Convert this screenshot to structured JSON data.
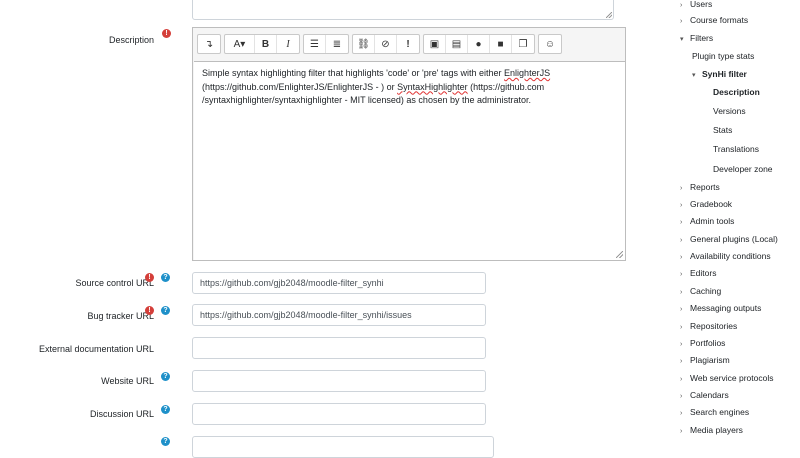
{
  "form": {
    "description": {
      "label": "Description",
      "content": {
        "part1": "Simple syntax highlighting filter that highlights 'code' or 'pre' tags with either ",
        "spell1": "EnlighterJS",
        "part2": " (https://github.com/EnlighterJS/EnlighterJS - ) or ",
        "spell2": "SyntaxHighlighter",
        "part3": " (https://github.com /syntaxhighlighter/syntaxhighlighter - MIT licensed) as chosen by the administrator."
      }
    },
    "source_control_url": {
      "label": "Source control URL",
      "value": "https://github.com/gjb2048/moodle-filter_synhi"
    },
    "bug_tracker_url": {
      "label": "Bug tracker URL",
      "value": "https://github.com/gjb2048/moodle-filter_synhi/issues"
    },
    "external_documentation_url": {
      "label": "External documentation URL",
      "value": ""
    },
    "website_url": {
      "label": "Website URL",
      "value": ""
    },
    "discussion_url": {
      "label": "Discussion URL",
      "value": ""
    }
  },
  "toolbar": {
    "icons": [
      "collapse-icon",
      "paragraph-style-icon",
      "bold-icon",
      "italic-icon",
      "unordered-list-icon",
      "ordered-list-icon",
      "link-icon",
      "unlink-icon",
      "emoji-picker-icon",
      "image-icon",
      "media-icon",
      "record-audio-icon",
      "record-video-icon",
      "manage-files-icon",
      "emoticon-icon"
    ]
  },
  "nav": {
    "items": [
      {
        "label": "Users",
        "caret": "right",
        "level": 0
      },
      {
        "label": "Course formats",
        "caret": "right",
        "level": 0
      },
      {
        "label": "Filters",
        "caret": "down",
        "level": 0
      },
      {
        "label": "Plugin type stats",
        "caret": "",
        "level": 1
      },
      {
        "label": "SynHi filter",
        "caret": "down",
        "level": 1,
        "bold": true
      },
      {
        "label": "Description",
        "caret": "",
        "level": 2,
        "bold": true
      },
      {
        "label": "Versions",
        "caret": "",
        "level": 2
      },
      {
        "label": "Stats",
        "caret": "",
        "level": 2
      },
      {
        "label": "Translations",
        "caret": "",
        "level": 2
      },
      {
        "label": "Developer zone",
        "caret": "",
        "level": 2
      },
      {
        "label": "Reports",
        "caret": "right",
        "level": 0
      },
      {
        "label": "Gradebook",
        "caret": "right",
        "level": 0
      },
      {
        "label": "Admin tools",
        "caret": "right",
        "level": 0
      },
      {
        "label": "General plugins (Local)",
        "caret": "right",
        "level": 0
      },
      {
        "label": "Availability conditions",
        "caret": "right",
        "level": 0
      },
      {
        "label": "Editors",
        "caret": "right",
        "level": 0
      },
      {
        "label": "Caching",
        "caret": "right",
        "level": 0
      },
      {
        "label": "Messaging outputs",
        "caret": "right",
        "level": 0
      },
      {
        "label": "Repositories",
        "caret": "right",
        "level": 0
      },
      {
        "label": "Portfolios",
        "caret": "right",
        "level": 0
      },
      {
        "label": "Plagiarism",
        "caret": "right",
        "level": 0
      },
      {
        "label": "Web service protocols",
        "caret": "right",
        "level": 0
      },
      {
        "label": "Calendars",
        "caret": "right",
        "level": 0
      },
      {
        "label": "Search engines",
        "caret": "right",
        "level": 0
      },
      {
        "label": "Media players",
        "caret": "right",
        "level": 0
      }
    ]
  },
  "colors": {
    "required": "#d43f3a",
    "help": "#1e90c9",
    "border": "#ced4da"
  }
}
